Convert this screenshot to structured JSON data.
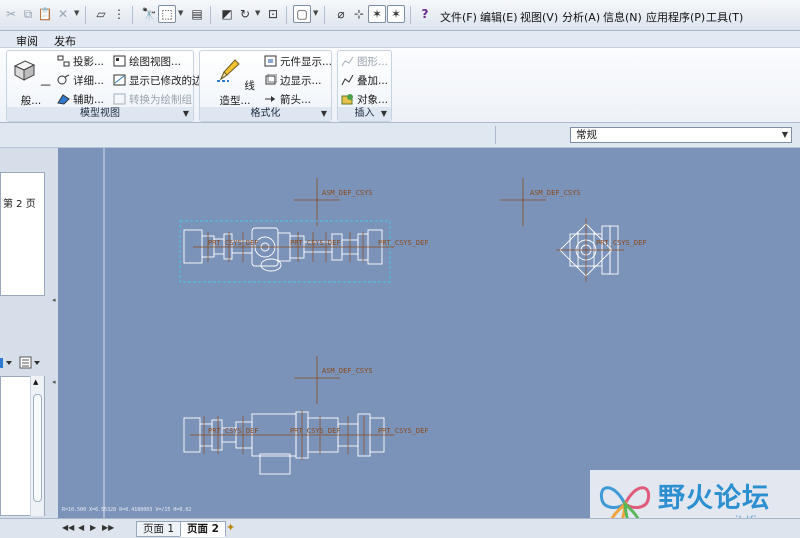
{
  "menubar": {
    "items": [
      "文件(F)",
      "编辑(E)",
      "视图(V)",
      "分析(A)",
      "信息(N)",
      "应用程序(P)",
      "工具(T)"
    ]
  },
  "ribbon_tabs": [
    "审阅",
    "发布"
  ],
  "ribbon": {
    "model_views": {
      "group_label": "模型视图",
      "general": "一般...",
      "projection": "投影...",
      "detailed": "详细...",
      "auxiliary": "辅助...",
      "drawing_view": "绘图视图...",
      "show_modified_edges": "显示已修改的边",
      "convert_to_draft_group": "转换为绘制组"
    },
    "format": {
      "group_label": "格式化",
      "line_style": "线造型...",
      "component_display": "元件显示...",
      "edge_display": "边显示...",
      "arrows": "箭头..."
    },
    "insert": {
      "group_label": "插入",
      "graphics": "图形...",
      "overlay": "叠加...",
      "object": "对象..."
    }
  },
  "view_filter": {
    "selected": "常规"
  },
  "left_panel": {
    "page_label": "第 2 页"
  },
  "drawing": {
    "csys_labels": [
      "ASM_DEF_CSYS",
      "ASM_DEF_CSYS",
      "ASM_DEF_CSYS"
    ],
    "top_view_label": "PRT_CSYS_DEF",
    "assembly_label": "PRT_CSYS_DEF",
    "coord_readout": "R=10.500   X=6.55328   R=0.4180003   V=/15   H=0.02"
  },
  "page_tabs": [
    "页面 1",
    "页面 2"
  ],
  "watermark": {
    "title": "野火论坛",
    "url": "www.proewildfire.cn"
  },
  "colors": {
    "canvas": "#7c93b9",
    "geometry": "#ffffff",
    "csys": "#8a4a1c",
    "selection": "#48c8e8"
  }
}
